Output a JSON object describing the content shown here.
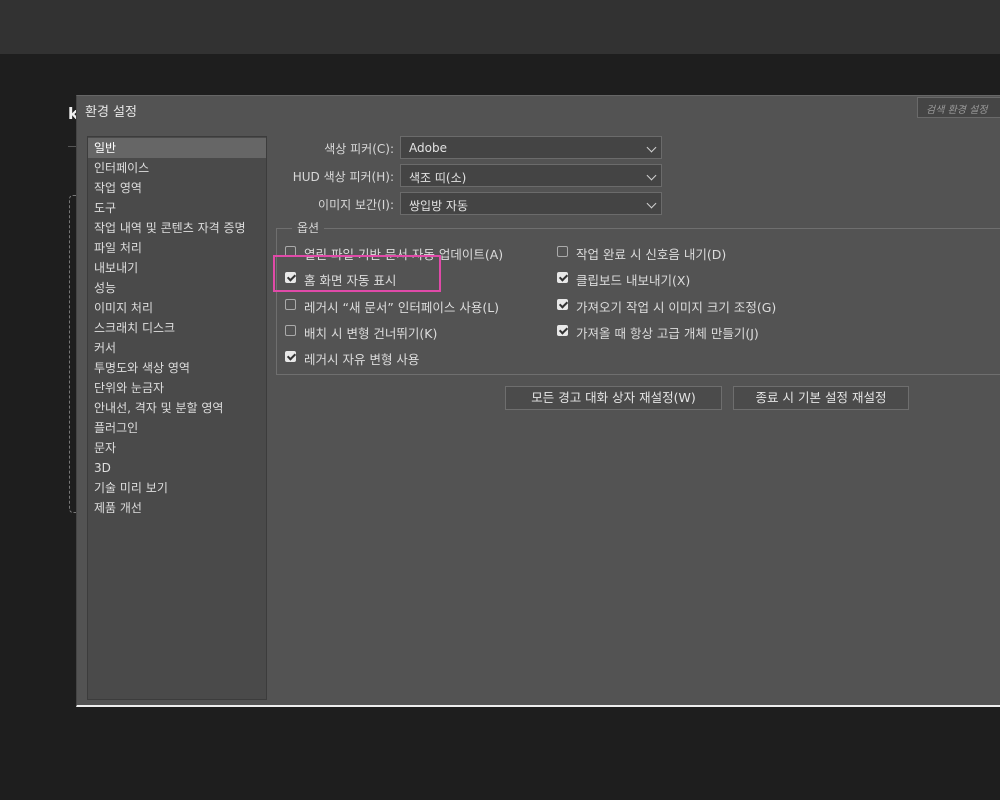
{
  "dialog": {
    "title": "환경 설정",
    "search_placeholder": "검색 환경 설정"
  },
  "background": {
    "letter": "k"
  },
  "nav": {
    "items": [
      "일반",
      "인터페이스",
      "작업 영역",
      "도구",
      "작업 내역 및 콘텐츠 자격 증명",
      "파일 처리",
      "내보내기",
      "성능",
      "이미지 처리",
      "스크래치 디스크",
      "커서",
      "투명도와 색상 영역",
      "단위와 눈금자",
      "안내선, 격자 및 분할 영역",
      "플러그인",
      "문자",
      "3D",
      "기술 미리 보기",
      "제품 개선"
    ],
    "selected": "일반"
  },
  "fields": {
    "color_picker": {
      "label": "색상 피커(C):",
      "value": "Adobe"
    },
    "hud_picker": {
      "label": "HUD 색상 피커(H):",
      "value": "색조 띠(소)"
    },
    "interpolation": {
      "label": "이미지 보간(I):",
      "value": "쌍입방 자동"
    }
  },
  "options": {
    "title": "옵션",
    "left": [
      {
        "label": "열린 파일 기반 문서 자동 업데이트(A)",
        "checked": false
      },
      {
        "label": "홈 화면 자동 표시",
        "checked": true
      },
      {
        "label": "레거시 “새 문서” 인터페이스 사용(L)",
        "checked": false
      },
      {
        "label": "배치 시 변형 건너뛰기(K)",
        "checked": false
      },
      {
        "label": "레거시 자유 변형 사용",
        "checked": true
      }
    ],
    "right": [
      {
        "label": "작업 완료 시 신호음 내기(D)",
        "checked": false
      },
      {
        "label": "클립보드 내보내기(X)",
        "checked": true
      },
      {
        "label": "가져오기 작업 시 이미지 크기 조정(G)",
        "checked": true
      },
      {
        "label": "가져올 때 항상 고급 개체 만들기(J)",
        "checked": true
      }
    ]
  },
  "buttons": {
    "reset_warnings": "모든 경고 대화 상자 재설정(W)",
    "reset_on_quit": "종료 시 기본 설정 재설정"
  },
  "colors": {
    "highlight": "#e04aa8",
    "dialog_bg": "#535353"
  }
}
